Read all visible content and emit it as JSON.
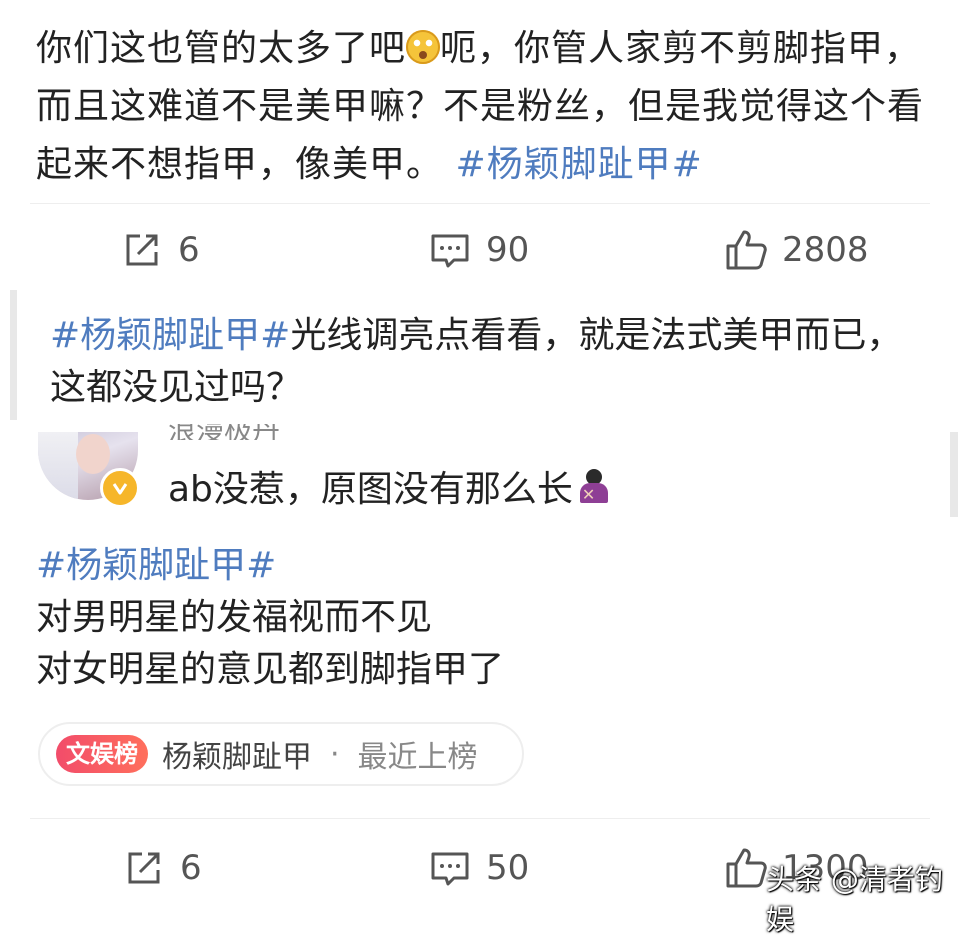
{
  "post1": {
    "text_before_emoji": "你们这也管的太多了吧",
    "emoji": "astonished-face-emoji",
    "text_after_emoji": "呃，你管人家剪不剪脚指甲，而且这难道不是美甲嘛？不是粉丝，但是我觉得这个看起来不想指甲，像美甲。",
    "hashtag": "#杨颖脚趾甲#"
  },
  "actions1": {
    "repost_count": "6",
    "comment_count": "90",
    "like_count": "2808"
  },
  "quote": {
    "hashtag": "#杨颖脚趾甲#",
    "text": "光线调亮点看看，就是法式美甲而已，这都没见过吗？"
  },
  "reply": {
    "username": "浪漫极丹",
    "text": "ab没惹，原图没有那么长",
    "emoji": "person-gesturing-no-emoji"
  },
  "post2": {
    "hashtag": "#杨颖脚趾甲#",
    "lines": [
      "对男明星的发福视而不见",
      "对女明星的意见都到脚指甲了"
    ]
  },
  "topic_pill": {
    "badge": "文娱榜",
    "topic": "杨颖脚趾甲",
    "separator": "·",
    "status": "最近上榜"
  },
  "actions2": {
    "repost_count": "6",
    "comment_count": "50",
    "like_count": "1300"
  },
  "watermark": "头条 @清者钓娱",
  "colors": {
    "hashtag": "#4f7cbf",
    "badge": "#f24c6a",
    "verified": "#f6b62a"
  }
}
